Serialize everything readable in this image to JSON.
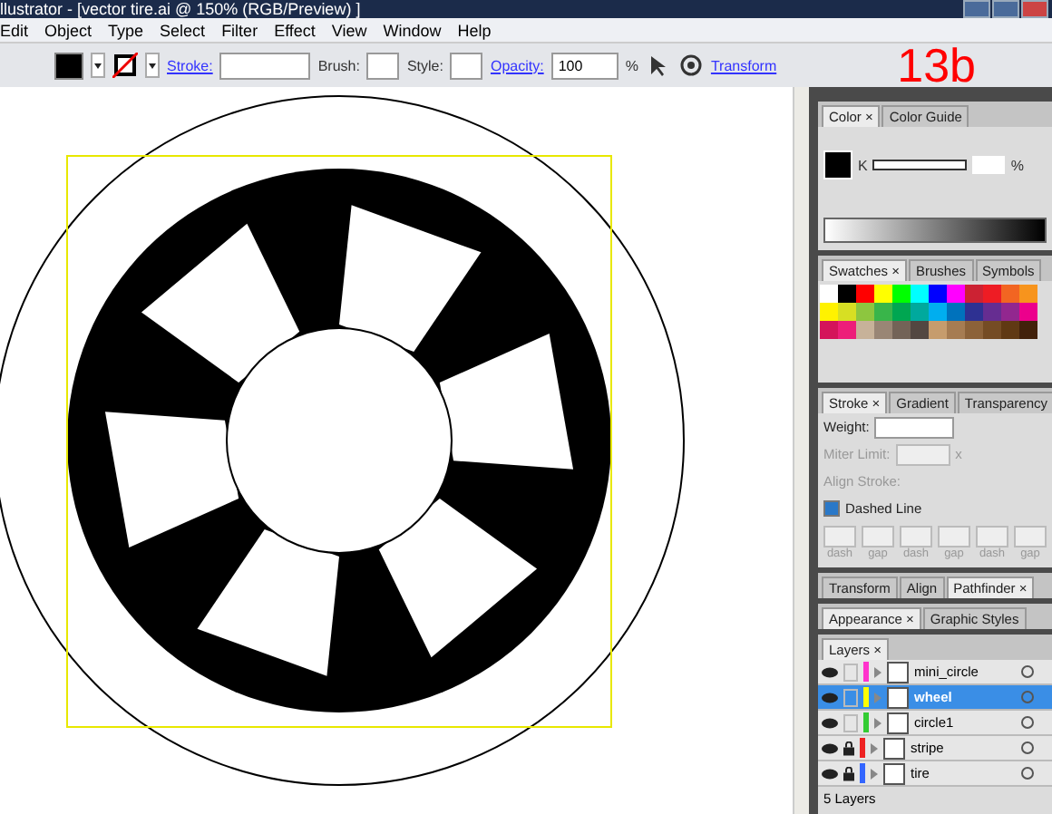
{
  "window": {
    "title": "llustrator - [vector tire.ai @ 150% (RGB/Preview) ]"
  },
  "menu": [
    "Edit",
    "Object",
    "Type",
    "Select",
    "Filter",
    "Effect",
    "View",
    "Window",
    "Help"
  ],
  "control_bar": {
    "stroke_label": "Stroke:",
    "brush_label": "Brush:",
    "style_label": "Style:",
    "opacity_label": "Opacity:",
    "opacity_value": "100",
    "percent": "%",
    "transform_label": "Transform"
  },
  "step_label": "13b",
  "color_panel": {
    "tabs": [
      {
        "label": "Color ×",
        "selected": true
      },
      {
        "label": "Color Guide",
        "selected": false
      }
    ],
    "channel": "K",
    "percent": "%"
  },
  "swatches_panel": {
    "tabs": [
      {
        "label": "Swatches ×",
        "selected": true
      },
      {
        "label": "Brushes",
        "selected": false
      },
      {
        "label": "Symbols",
        "selected": false
      }
    ],
    "swatches": [
      {
        "color": "#ffffff"
      },
      {
        "color": "#000000"
      },
      {
        "color": "#ff0000"
      },
      {
        "color": "#ffff00"
      },
      {
        "color": "#00ff00"
      },
      {
        "color": "#00ffff"
      },
      {
        "color": "#0000ff"
      },
      {
        "color": "#ff00ff"
      },
      {
        "color": "#cc2233"
      },
      {
        "color": "#ee1c24"
      },
      {
        "color": "#f26522"
      },
      {
        "color": "#f7941d"
      },
      {
        "color": "#fff200"
      },
      {
        "color": "#d7df23"
      },
      {
        "color": "#8dc63f"
      },
      {
        "color": "#39b54a"
      },
      {
        "color": "#00a651"
      },
      {
        "color": "#00a99d"
      },
      {
        "color": "#00aeef"
      },
      {
        "color": "#0072bc"
      },
      {
        "color": "#2e3192"
      },
      {
        "color": "#662d91"
      },
      {
        "color": "#92278f"
      },
      {
        "color": "#ec008c"
      },
      {
        "color": "#d4145a"
      },
      {
        "color": "#ed1e79"
      },
      {
        "color": "#c7b299"
      },
      {
        "color": "#998675"
      },
      {
        "color": "#736357"
      },
      {
        "color": "#534741"
      },
      {
        "color": "#c69c6d"
      },
      {
        "color": "#a67c52"
      },
      {
        "color": "#8c6239"
      },
      {
        "color": "#754c24"
      },
      {
        "color": "#603913"
      },
      {
        "color": "#42210b"
      }
    ]
  },
  "stroke_panel": {
    "tabs": [
      {
        "label": "Stroke ×",
        "selected": true
      },
      {
        "label": "Gradient",
        "selected": false
      },
      {
        "label": "Transparency",
        "selected": false
      }
    ],
    "weight_label": "Weight:",
    "miter_label": "Miter Limit:",
    "miter_x": "x",
    "align_label": "Align Stroke:",
    "dashed_label": "Dashed Line",
    "dashed_checked": true,
    "dash_labels": [
      "dash",
      "gap",
      "dash",
      "gap",
      "dash",
      "gap"
    ]
  },
  "pathfinder_tabs": [
    {
      "label": "Transform",
      "selected": false
    },
    {
      "label": "Align",
      "selected": false
    },
    {
      "label": "Pathfinder ×",
      "selected": true
    }
  ],
  "appearance_tabs": [
    {
      "label": "Appearance ×",
      "selected": true
    },
    {
      "label": "Graphic Styles",
      "selected": false
    }
  ],
  "layers_panel": {
    "tabs": [
      {
        "label": "Layers ×",
        "selected": true
      }
    ],
    "layers": [
      {
        "name": "mini_circle",
        "color": "#ff33cc",
        "locked": false,
        "selected": false
      },
      {
        "name": "wheel",
        "color": "#ffff00",
        "locked": false,
        "selected": true
      },
      {
        "name": "circle1",
        "color": "#33cc33",
        "locked": false,
        "selected": false
      },
      {
        "name": "stripe",
        "color": "#ee2222",
        "locked": true,
        "selected": false
      },
      {
        "name": "tire",
        "color": "#3366ff",
        "locked": true,
        "selected": false
      }
    ],
    "count": "5 Layers"
  }
}
